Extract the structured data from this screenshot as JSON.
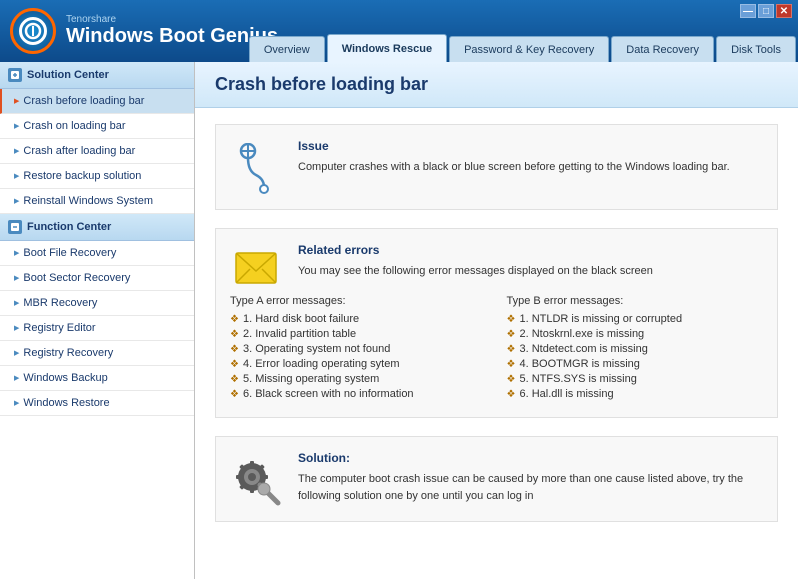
{
  "titleBar": {
    "vendor": "Tenorshare",
    "appName": "Windows Boot Genius",
    "controls": {
      "minimize": "—",
      "maximize": "□",
      "close": "✕"
    }
  },
  "navTabs": [
    {
      "id": "overview",
      "label": "Overview",
      "active": false
    },
    {
      "id": "windows-rescue",
      "label": "Windows Rescue",
      "active": true
    },
    {
      "id": "password-recovery",
      "label": "Password & Key Recovery",
      "active": false
    },
    {
      "id": "data-recovery",
      "label": "Data Recovery",
      "active": false
    },
    {
      "id": "disk-tools",
      "label": "Disk Tools",
      "active": false
    }
  ],
  "sidebar": {
    "solutionCenter": {
      "header": "Solution Center",
      "items": [
        {
          "id": "crash-before-loading-bar",
          "label": "Crash before loading bar",
          "active": true
        },
        {
          "id": "crash-on-loading-bar",
          "label": "Crash on loading bar",
          "active": false
        },
        {
          "id": "crash-after-loading-bar",
          "label": "Crash after loading bar",
          "active": false
        },
        {
          "id": "restore-backup-solution",
          "label": "Restore backup solution",
          "active": false
        },
        {
          "id": "reinstall-windows-system",
          "label": "Reinstall Windows System",
          "active": false
        }
      ]
    },
    "functionCenter": {
      "header": "Function Center",
      "items": [
        {
          "id": "boot-file-recovery",
          "label": "Boot File Recovery",
          "active": false
        },
        {
          "id": "boot-sector-recovery",
          "label": "Boot Sector Recovery",
          "active": false
        },
        {
          "id": "mbr-recovery",
          "label": "MBR Recovery",
          "active": false
        },
        {
          "id": "registry-editor",
          "label": "Registry Editor",
          "active": false
        },
        {
          "id": "registry-recovery",
          "label": "Registry Recovery",
          "active": false
        },
        {
          "id": "windows-backup",
          "label": "Windows Backup",
          "active": false
        },
        {
          "id": "windows-restore",
          "label": "Windows Restore",
          "active": false
        }
      ]
    }
  },
  "content": {
    "pageTitle": "Crash before loading bar",
    "issue": {
      "title": "Issue",
      "text": "Computer crashes with a black or blue screen before getting to the Windows loading bar."
    },
    "relatedErrors": {
      "title": "Related errors",
      "description": "You may see the following error messages displayed on the black screen",
      "typeA": {
        "header": "Type A error messages:",
        "items": [
          "1. Hard disk boot failure",
          "2. Invalid partition table",
          "3. Operating system not found",
          "4. Error loading operating sytem",
          "5. Missing operating system",
          "6. Black screen with no information"
        ]
      },
      "typeB": {
        "header": "Type B error messages:",
        "items": [
          "1. NTLDR is missing or corrupted",
          "2. Ntoskrnl.exe is missing",
          "3. Ntdetect.com is missing",
          "4. BOOTMGR is missing",
          "5. NTFS.SYS is missing",
          "6. Hal.dll is missing"
        ]
      }
    },
    "solution": {
      "title": "Solution:",
      "text": "The computer boot crash issue can be caused by more than one cause listed above, try the following solution one by one until you can log in"
    }
  }
}
